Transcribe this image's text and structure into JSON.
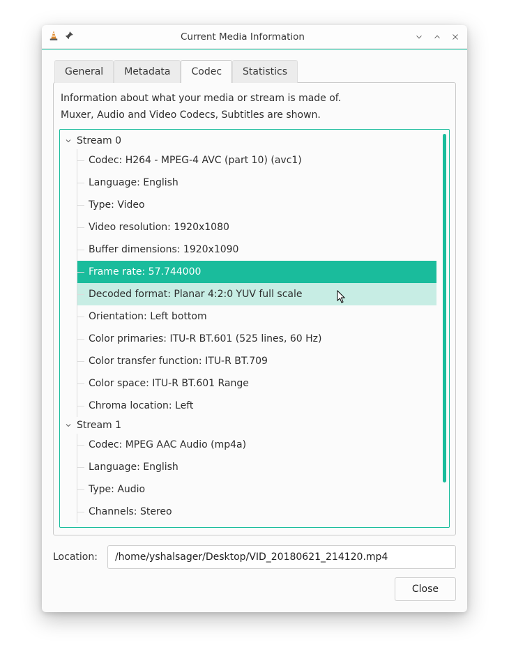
{
  "window": {
    "title": "Current Media Information"
  },
  "tabs": {
    "general": "General",
    "metadata": "Metadata",
    "codec": "Codec",
    "statistics": "Statistics",
    "active": "codec"
  },
  "info": {
    "line1": "Information about what your media or stream is made of.",
    "line2": "Muxer, Audio and Video Codecs, Subtitles are shown."
  },
  "streams": [
    {
      "label": "Stream 0",
      "rows": [
        "Codec: H264 - MPEG-4 AVC (part 10) (avc1)",
        "Language: English",
        "Type: Video",
        "Video resolution: 1920x1080",
        "Buffer dimensions: 1920x1090",
        "Frame rate: 57.744000",
        "Decoded format: Planar 4:2:0 YUV full scale",
        "Orientation: Left bottom",
        "Color primaries: ITU-R BT.601 (525 lines, 60 Hz)",
        "Color transfer function: ITU-R BT.709",
        "Color space: ITU-R BT.601 Range",
        "Chroma location: Left"
      ],
      "selected_index": 5,
      "hover_index": 6
    },
    {
      "label": "Stream 1",
      "rows": [
        "Codec: MPEG AAC Audio (mp4a)",
        "Language: English",
        "Type: Audio",
        "Channels: Stereo"
      ]
    }
  ],
  "footer": {
    "location_label": "Location:",
    "location_value": "/home/yshalsager/Desktop/VID_20180621_214120.mp4",
    "close_label": "Close"
  },
  "colors": {
    "accent": "#1abc9c"
  }
}
